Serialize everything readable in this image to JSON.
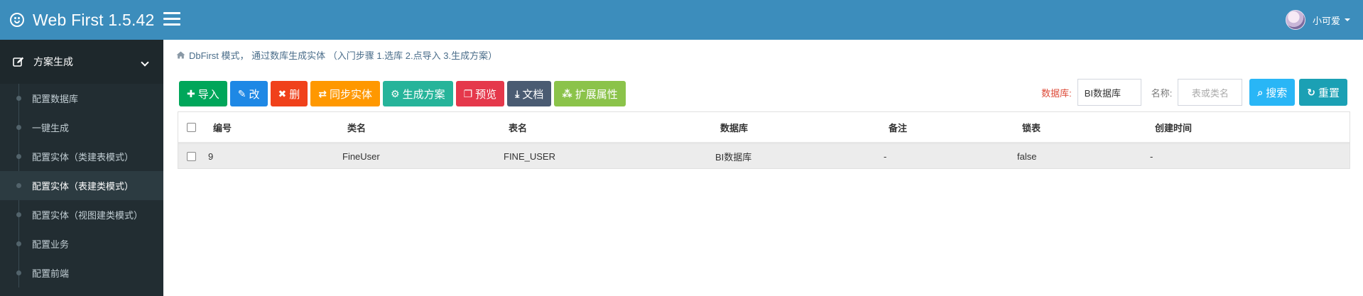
{
  "app": {
    "title": "Web First 1.5.42"
  },
  "user": {
    "name": "小可爱"
  },
  "sidebar": {
    "section": "方案生成",
    "items": [
      {
        "label": "配置数据库"
      },
      {
        "label": "一键生成"
      },
      {
        "label": "配置实体（类建表模式）"
      },
      {
        "label": "配置实体（表建类模式）",
        "active": true
      },
      {
        "label": "配置实体（视图建类模式）"
      },
      {
        "label": "配置业务"
      },
      {
        "label": "配置前端"
      }
    ]
  },
  "breadcrumb": {
    "text": "DbFirst 模式， 通过数库生成实体 （入门步骤 1.选库 2.点导入 3.生成方案）"
  },
  "toolbar": {
    "import": "导入",
    "edit": "改",
    "delete": "删",
    "sync": "同步实体",
    "generate": "生成方案",
    "preview": "预览",
    "docs": "文档",
    "extend": "扩展属性"
  },
  "filters": {
    "db_label": "数据库:",
    "db_value": "BI数据库",
    "name_label": "名称:",
    "name_placeholder": "表或类名",
    "search": "搜索",
    "reset": "重置"
  },
  "table": {
    "columns": [
      "编号",
      "类名",
      "表名",
      "数据库",
      "备注",
      "锁表",
      "创建时间"
    ],
    "rows": [
      [
        "9",
        "FineUser",
        "FINE_USER",
        "BI数据库",
        "-",
        "false",
        "-"
      ]
    ]
  },
  "colors": {
    "header": "#3c8dbc",
    "sidebar": "#222d32"
  }
}
